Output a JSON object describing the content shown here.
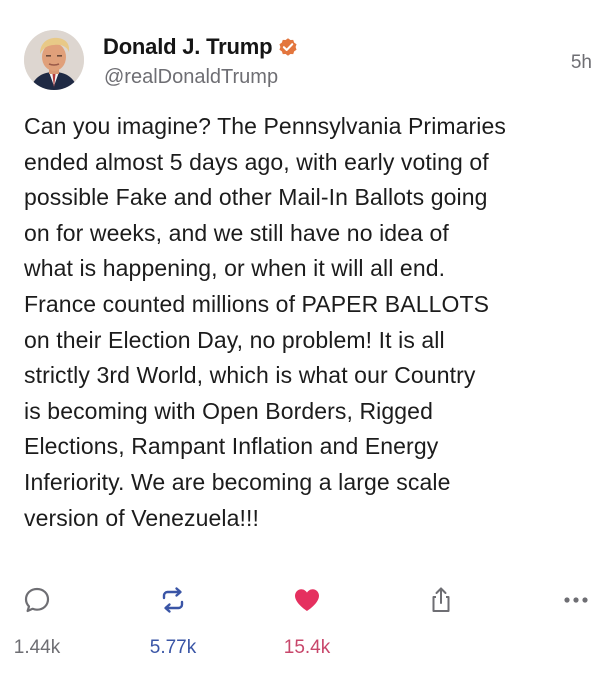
{
  "post": {
    "author": {
      "display_name": "Donald J. Trump",
      "handle": "@realDonaldTrump",
      "verified": true,
      "avatar_icon": "profile-photo"
    },
    "time_ago": "5h",
    "body_lines": [
      "Can you imagine? The Pennsylvania Primaries",
      "ended almost 5 days ago, with early voting of",
      "possible Fake and other Mail-In Ballots going",
      "on for weeks, and we still have no idea of",
      "what is happening, or when it will all end.",
      "France counted millions of PAPER BALLOTS",
      "on their Election Day, no problem! It is all",
      "strictly 3rd World, which is what our Country",
      "is becoming with Open Borders, Rigged",
      "Elections, Rampant Inflation and Energy",
      "Inferiority. We are becoming a large scale",
      "version of Venezuela!!!"
    ],
    "actions": {
      "reply": {
        "icon": "reply-bubble-icon",
        "count": "1.44k",
        "color": "#6e6e73"
      },
      "retruth": {
        "icon": "retruth-icon",
        "count": "5.77k",
        "color": "#3a55a6"
      },
      "like": {
        "icon": "heart-icon",
        "count": "15.4k",
        "color": "#e5305f"
      },
      "share": {
        "icon": "share-icon",
        "count": ""
      },
      "more": {
        "icon": "more-icon",
        "count": ""
      }
    },
    "colors": {
      "verified_badge": "#e3763e",
      "text": "#1c1c1c",
      "secondary_text": "#6e6e73"
    }
  }
}
